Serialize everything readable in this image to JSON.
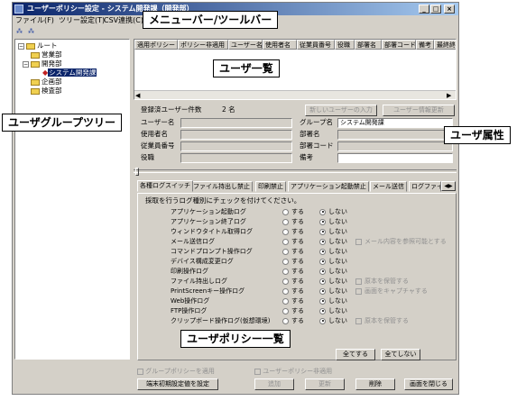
{
  "window": {
    "title": "ユーザーポリシー設定 - システム開発課（開発部）",
    "min": "_",
    "max": "□",
    "close": "×"
  },
  "menu": [
    "ファイル(F)",
    "ツリー設定(T)",
    "CSV連携(C)"
  ],
  "tree": {
    "root": "ルート",
    "items": [
      "営業部",
      "開発部",
      "システム開発課",
      "企画部",
      "検査部"
    ],
    "expanders": {
      "root": "−",
      "dev": "−"
    }
  },
  "user_list": {
    "columns": [
      "適用ポリシー",
      "ポリシー非適用",
      "ユーザー名",
      "使用者名",
      "従業員番号",
      "役職",
      "部署名",
      "部署コード",
      "備考",
      "最終終"
    ]
  },
  "attributes": {
    "registered_label": "登録済ユーザー件数",
    "registered_count": "2 名",
    "new_user_button": "新しいユーザーの入力",
    "update_button": "ユーザー情報更新",
    "fields_left": [
      "ユーザー名",
      "使用者名",
      "従業員番号",
      "役職"
    ],
    "fields_right": [
      "グループ名",
      "部署名",
      "部署コード",
      "備考"
    ],
    "group_value": "システム開発課"
  },
  "policy": {
    "tabs": [
      "各種ログスイッチ",
      "ファイル持出し禁止",
      "印刷禁止",
      "アプリケーション起動禁止",
      "メール送信",
      "ログファイル"
    ],
    "instruction": "採取を行うログ種別にチェックを付けてください。",
    "on_label": "する",
    "off_label": "しない",
    "rows": [
      {
        "name": "アプリケーション起動ログ",
        "extra": ""
      },
      {
        "name": "アプリケーション終了ログ",
        "extra": ""
      },
      {
        "name": "ウィンドウタイトル取得ログ",
        "extra": ""
      },
      {
        "name": "メール送信ログ",
        "extra": "メール内容を参照可能とする"
      },
      {
        "name": "コマンドプロンプト操作ログ",
        "extra": ""
      },
      {
        "name": "デバイス構成変更ログ",
        "extra": ""
      },
      {
        "name": "印刷操作ログ",
        "extra": ""
      },
      {
        "name": "ファイル持出しログ",
        "extra": "原本を保管する"
      },
      {
        "name": "PrintScreenキー操作ログ",
        "extra": "画面をキャプチャする"
      },
      {
        "name": "Web操作ログ",
        "extra": ""
      },
      {
        "name": "FTP操作ログ",
        "extra": ""
      },
      {
        "name": "クリップボード操作ログ(仮想環境)",
        "extra": "原本を保管する"
      }
    ],
    "all_on": "全てする",
    "all_off": "全てしない"
  },
  "footer": {
    "group_policy": "グループポリシーを適用",
    "user_policy_off": "ユーザーポリシー非適用",
    "init_button": "端末初期設定値を設定",
    "add": "追加",
    "update": "更新",
    "delete": "削除",
    "close": "画面を閉じる"
  },
  "callouts": {
    "menubar": "メニューバー/ツールバー",
    "user_list": "ユーザ一覧",
    "group_tree": "ユーザグループツリー",
    "attributes": "ユーザ属性",
    "policy_list": "ユーザポリシー一覧"
  }
}
